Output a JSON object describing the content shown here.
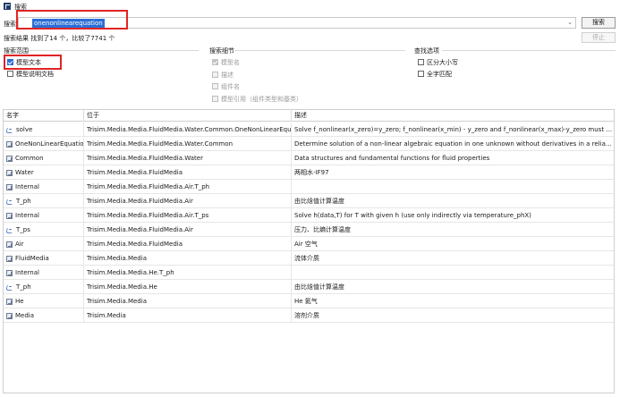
{
  "window": {
    "title": "搜索"
  },
  "search": {
    "label": "搜索",
    "value": "onenonlinearequation",
    "button": "搜索",
    "stop": "停止"
  },
  "result": {
    "text": "搜索结果  找到了14 个，比较了7741 个"
  },
  "scope": {
    "title": "搜索范围",
    "options": [
      {
        "label": "模型文本",
        "checked": true
      },
      {
        "label": "模型说明文档",
        "checked": false
      }
    ]
  },
  "details": {
    "title": "搜索细节",
    "options": [
      {
        "label": "模型名",
        "checked": true
      },
      {
        "label": "描述",
        "checked": false
      },
      {
        "label": "组件名",
        "checked": false
      },
      {
        "label": "模型引用（组件类型和基类）",
        "checked": false
      }
    ]
  },
  "find": {
    "title": "查找选项",
    "options": [
      {
        "label": "区分大小写",
        "checked": false
      },
      {
        "label": "全字匹配",
        "checked": false
      }
    ]
  },
  "table": {
    "columns": [
      "名字",
      "位于",
      "描述"
    ],
    "rows": [
      {
        "icon": "function-icon",
        "name": "solve",
        "location": "Trisim.Media.Media.FluidMedia.Water.Common.OneNonLinearEquation",
        "desc": "Solve f_nonlinear(x_zero)=y_zero; f_nonlinear(x_min) - y_zero and f_nonlinear(x_max)-y_zero must have differen..."
      },
      {
        "icon": "class-icon",
        "name": "OneNonLinearEquation",
        "location": "Trisim.Media.Media.FluidMedia.Water.Common",
        "desc": "Determine solution of a non-linear algebraic equation in one unknown without derivatives in a reliable and ..."
      },
      {
        "icon": "class-icon",
        "name": "Common",
        "location": "Trisim.Media.Media.FluidMedia.Water",
        "desc": "Data structures and fundamental functions for fluid properties"
      },
      {
        "icon": "class-icon",
        "name": "Water",
        "location": "Trisim.Media.Media.FluidMedia",
        "desc": "两相水-IF97"
      },
      {
        "icon": "class-icon",
        "name": "Internal",
        "location": "Trisim.Media.Media.FluidMedia.Air.T_ph",
        "desc": ""
      },
      {
        "icon": "function-icon",
        "name": "T_ph",
        "location": "Trisim.Media.Media.FluidMedia.Air",
        "desc": "由比焓值计算温度"
      },
      {
        "icon": "class-icon",
        "name": "Internal",
        "location": "Trisim.Media.Media.FluidMedia.Air.T_ps",
        "desc": "Solve h(data,T) for T with given h (use only indirectly via temperature_phX)"
      },
      {
        "icon": "function-icon",
        "name": "T_ps",
        "location": "Trisim.Media.Media.FluidMedia.Air",
        "desc": "压力、比熵计算温度"
      },
      {
        "icon": "class-icon",
        "name": "Air",
        "location": "Trisim.Media.Media.FluidMedia",
        "desc": "Air 空气"
      },
      {
        "icon": "class-icon",
        "name": "FluidMedia",
        "location": "Trisim.Media.Media",
        "desc": "流体介质"
      },
      {
        "icon": "class-icon",
        "name": "Internal",
        "location": "Trisim.Media.Media.He.T_ph",
        "desc": ""
      },
      {
        "icon": "function-icon",
        "name": "T_ph",
        "location": "Trisim.Media.Media.He",
        "desc": "由比焓值计算温度"
      },
      {
        "icon": "class-icon",
        "name": "He",
        "location": "Trisim.Media.Media",
        "desc": "He 氦气"
      },
      {
        "icon": "class-icon",
        "name": "Media",
        "location": "Trisim.Media",
        "desc": "溶剂介质"
      }
    ]
  }
}
